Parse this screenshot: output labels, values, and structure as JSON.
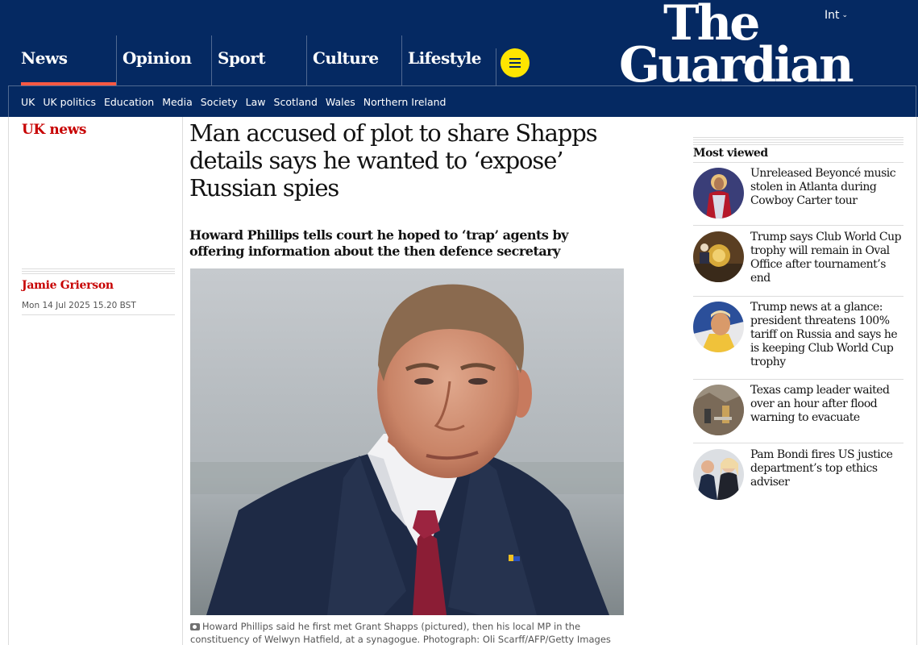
{
  "header": {
    "edition": "Int",
    "logo_line1": "The",
    "logo_line2": "Guardian",
    "pillars": [
      {
        "label": "News",
        "active": true
      },
      {
        "label": "Opinion",
        "active": false
      },
      {
        "label": "Sport",
        "active": false
      },
      {
        "label": "Culture",
        "active": false
      },
      {
        "label": "Lifestyle",
        "active": false
      }
    ],
    "menu_icon": "hamburger-icon",
    "subnav": [
      "UK",
      "UK politics",
      "Education",
      "Media",
      "Society",
      "Law",
      "Scotland",
      "Wales",
      "Northern Ireland"
    ]
  },
  "article": {
    "section": "UK news",
    "author": "Jamie Grierson",
    "date": "Mon 14 Jul 2025 15.20 BST",
    "headline": "Man accused of plot to share Shapps details says he wanted to ‘expose’ Russian spies",
    "standfirst": "Howard Phillips tells court he hoped to ‘trap’ agents by offering information about the then defence secretary",
    "caption": "Howard Phillips said he first met Grant Shapps (pictured), then his local MP in the constituency of Welwyn Hatfield, at a synagogue. Photograph: Oli Scarff/AFP/Getty Images"
  },
  "most_viewed": {
    "title": "Most viewed",
    "items": [
      {
        "title": "Unreleased Beyoncé music stolen in Atlanta during Cowboy Carter tour"
      },
      {
        "title": "Trump says Club World Cup trophy will remain in Oval Office after tournament’s end"
      },
      {
        "title": "Trump news at a glance: president threatens 100% tariff on Russia and says he is keeping Club World Cup trophy"
      },
      {
        "title": "Texas camp leader waited over an hour after flood warning to evacuate"
      },
      {
        "title": "Pam Bondi fires US justice department’s top ethics adviser"
      }
    ]
  },
  "colors": {
    "brand_blue": "#052962",
    "news_red": "#c70000",
    "menu_yellow": "#ffe500",
    "active_underline": "#ff5943"
  }
}
